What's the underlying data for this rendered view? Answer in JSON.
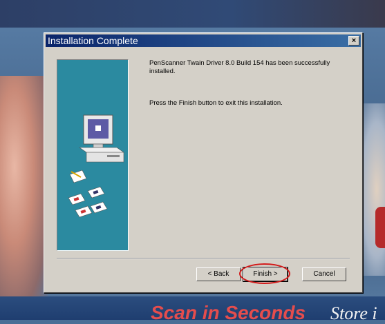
{
  "dialog": {
    "title": "Installation Complete",
    "close_symbol": "×",
    "message_installed": "PenScanner Twain Driver 8.0 Build 154 has been successfully installed.",
    "message_finish": "Press the Finish button to exit this installation."
  },
  "buttons": {
    "back_label": "< Back",
    "finish_label": "Finish >",
    "cancel_label": "Cancel"
  },
  "background": {
    "slogan_red": "Scan in Seconds",
    "slogan_white": "Store i"
  },
  "icons": {
    "computer": "computer-icon",
    "floppies": "floppy-disks-icon",
    "close": "close-icon"
  },
  "colors": {
    "title_gradient_start": "#0a246a",
    "title_gradient_end": "#3a6ea5",
    "art_panel": "#2b8aa0",
    "highlight_circle": "#d31c1c"
  }
}
